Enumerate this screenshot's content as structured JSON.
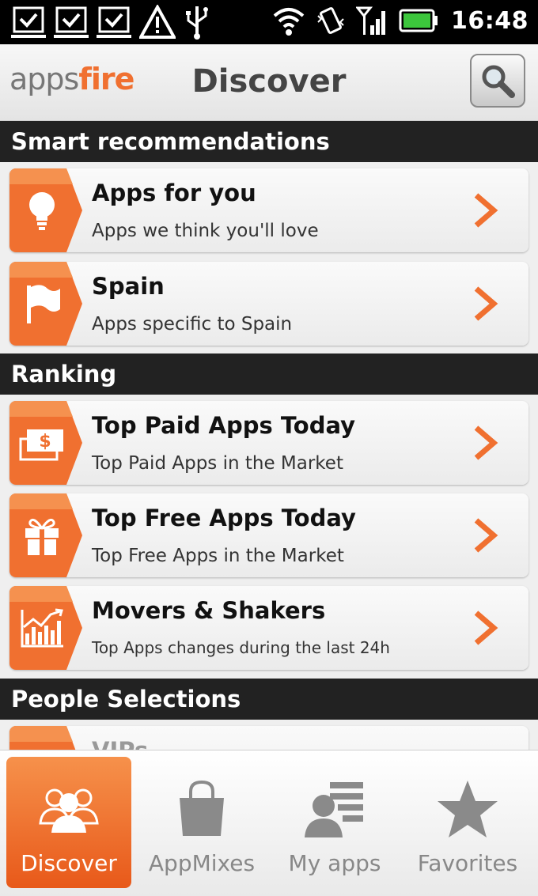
{
  "status_bar": {
    "time": "16:48"
  },
  "header": {
    "logo_part1": "apps",
    "logo_part2": "fire",
    "title": "Discover"
  },
  "sections": {
    "smart": {
      "title": "Smart recommendations"
    },
    "ranking": {
      "title": "Ranking"
    },
    "people": {
      "title": "People Selections"
    }
  },
  "items": {
    "apps_for_you": {
      "title": "Apps for you",
      "subtitle": "Apps we think you'll love",
      "icon": "lightbulb-icon"
    },
    "spain": {
      "title": "Spain",
      "subtitle": "Apps specific to Spain",
      "icon": "flag-icon"
    },
    "top_paid": {
      "title": "Top Paid Apps Today",
      "subtitle": "Top Paid Apps in the Market",
      "icon": "money-icon"
    },
    "top_free": {
      "title": "Top Free Apps Today",
      "subtitle": "Top Free Apps in the Market",
      "icon": "gift-icon"
    },
    "movers": {
      "title": "Movers & Shakers",
      "subtitle": "Top Apps changes during the last 24h",
      "icon": "chart-icon"
    },
    "vips": {
      "title": "VIPs"
    }
  },
  "tabs": {
    "discover": {
      "label": "Discover",
      "active": true
    },
    "appmixes": {
      "label": "AppMixes"
    },
    "myapps": {
      "label": "My apps"
    },
    "favorites": {
      "label": "Favorites"
    }
  },
  "colors": {
    "accent": "#f07030",
    "section_bg": "#222222"
  }
}
